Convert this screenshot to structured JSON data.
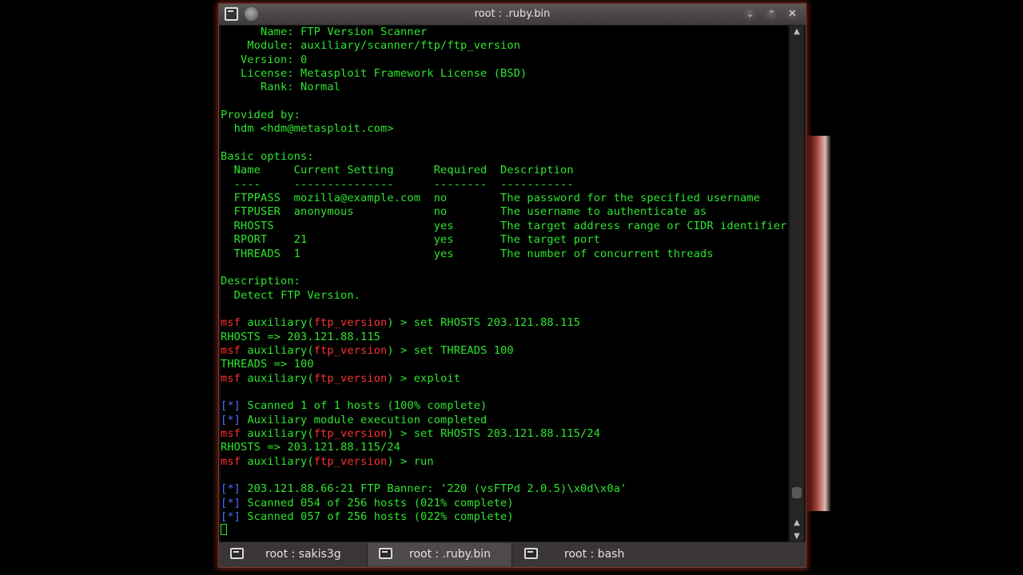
{
  "window": {
    "title": "root : .ruby.bin",
    "controls": {
      "minimize": "⌄",
      "maximize": "⌃",
      "close": "✕"
    }
  },
  "terminal": {
    "lines": [
      [
        {
          "t": "      Name: FTP Version Scanner"
        }
      ],
      [
        {
          "t": "    Module: auxiliary/scanner/ftp/ftp_version"
        }
      ],
      [
        {
          "t": "   Version: 0"
        }
      ],
      [
        {
          "t": "   License: Metasploit Framework License (BSD)"
        }
      ],
      [
        {
          "t": "      Rank: Normal"
        }
      ],
      [
        {
          "t": ""
        }
      ],
      [
        {
          "t": "Provided by:"
        }
      ],
      [
        {
          "t": "  hdm <hdm@metasploit.com>"
        }
      ],
      [
        {
          "t": ""
        }
      ],
      [
        {
          "t": "Basic options:"
        }
      ],
      [
        {
          "t": "  Name     Current Setting      Required  Description"
        }
      ],
      [
        {
          "t": "  ----     ---------------      --------  -----------"
        }
      ],
      [
        {
          "t": "  FTPPASS  mozilla@example.com  no        The password for the specified username"
        }
      ],
      [
        {
          "t": "  FTPUSER  anonymous            no        The username to authenticate as"
        }
      ],
      [
        {
          "t": "  RHOSTS                        yes       The target address range or CIDR identifier"
        }
      ],
      [
        {
          "t": "  RPORT    21                   yes       The target port"
        }
      ],
      [
        {
          "t": "  THREADS  1                    yes       The number of concurrent threads"
        }
      ],
      [
        {
          "t": ""
        }
      ],
      [
        {
          "t": "Description:"
        }
      ],
      [
        {
          "t": "  Detect FTP Version."
        }
      ],
      [
        {
          "t": ""
        }
      ],
      [
        {
          "t": "msf",
          "c": "red"
        },
        {
          "t": " auxiliary("
        },
        {
          "t": "ftp_version",
          "c": "red"
        },
        {
          "t": ") > set RHOSTS 203.121.88.115"
        }
      ],
      [
        {
          "t": "RHOSTS => 203.121.88.115"
        }
      ],
      [
        {
          "t": "msf",
          "c": "red"
        },
        {
          "t": " auxiliary("
        },
        {
          "t": "ftp_version",
          "c": "red"
        },
        {
          "t": ") > set THREADS 100"
        }
      ],
      [
        {
          "t": "THREADS => 100"
        }
      ],
      [
        {
          "t": "msf",
          "c": "red"
        },
        {
          "t": " auxiliary("
        },
        {
          "t": "ftp_version",
          "c": "red"
        },
        {
          "t": ") > exploit"
        }
      ],
      [
        {
          "t": ""
        }
      ],
      [
        {
          "t": "[*]",
          "c": "blue"
        },
        {
          "t": " Scanned 1 of 1 hosts (100% complete)"
        }
      ],
      [
        {
          "t": "[*]",
          "c": "blue"
        },
        {
          "t": " Auxiliary module execution completed"
        }
      ],
      [
        {
          "t": "msf",
          "c": "red"
        },
        {
          "t": " auxiliary("
        },
        {
          "t": "ftp_version",
          "c": "red"
        },
        {
          "t": ") > set RHOSTS 203.121.88.115/24"
        }
      ],
      [
        {
          "t": "RHOSTS => 203.121.88.115/24"
        }
      ],
      [
        {
          "t": "msf",
          "c": "red"
        },
        {
          "t": " auxiliary("
        },
        {
          "t": "ftp_version",
          "c": "red"
        },
        {
          "t": ") > run"
        }
      ],
      [
        {
          "t": ""
        }
      ],
      [
        {
          "t": "[*]",
          "c": "blue"
        },
        {
          "t": " 203.121.88.66:21 FTP Banner: '220 (vsFTPd 2.0.5)\\x0d\\x0a'"
        }
      ],
      [
        {
          "t": "[*]",
          "c": "blue"
        },
        {
          "t": " Scanned 054 of 256 hosts (021% complete)"
        }
      ],
      [
        {
          "t": "[*]",
          "c": "blue"
        },
        {
          "t": " Scanned 057 of 256 hosts (022% complete)"
        }
      ]
    ]
  },
  "tabs": [
    {
      "label": "root : sakis3g",
      "active": false
    },
    {
      "label": "root : .ruby.bin",
      "active": true
    },
    {
      "label": "root : bash",
      "active": false
    }
  ],
  "colors": {
    "text_green": "#2ee62e",
    "prompt_red": "#ff3030",
    "marker_blue": "#4f6dff"
  },
  "icons": {
    "window_app": "terminal-icon",
    "window_pin": "pin-icon",
    "tab": "terminal-tab-icon"
  }
}
